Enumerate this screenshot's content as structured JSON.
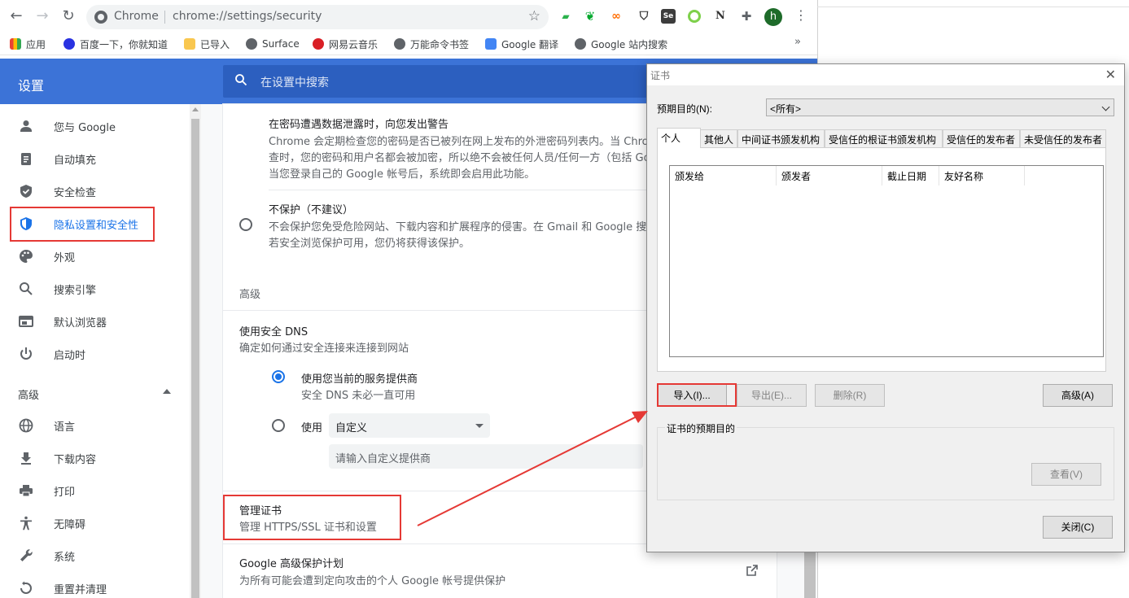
{
  "browser": {
    "omnibox_site": "Chrome",
    "url": "chrome://settings/security",
    "bookmarks": [
      "应用",
      "百度一下，你就知道",
      "已导入",
      "Surface",
      "网易云音乐",
      "万能命令书签",
      "Google 翻译",
      "Google 站内搜索"
    ],
    "more": "»",
    "avatar_letter": "h",
    "extension_icons": [
      "feedly-icon",
      "evernote-icon",
      "infinity-icon",
      "shield-extension-icon",
      "selenium-icon",
      "circle-extension-icon",
      "notion-icon",
      "puzzle-icon"
    ]
  },
  "settings": {
    "title": "设置",
    "search_placeholder": "在设置中搜索",
    "sidebar": [
      {
        "label": "您与 Google",
        "icon": "person-icon"
      },
      {
        "label": "自动填充",
        "icon": "clipboard-icon"
      },
      {
        "label": "安全检查",
        "icon": "shield-check-icon"
      },
      {
        "label": "隐私设置和安全性",
        "icon": "shield-privacy-icon"
      },
      {
        "label": "外观",
        "icon": "palette-icon"
      },
      {
        "label": "搜索引擎",
        "icon": "search-icon"
      },
      {
        "label": "默认浏览器",
        "icon": "browser-icon"
      },
      {
        "label": "启动时",
        "icon": "power-icon"
      }
    ],
    "sidebar_advanced": "高级",
    "sidebar_advanced_items": [
      {
        "label": "语言",
        "icon": "globe-icon"
      },
      {
        "label": "下载内容",
        "icon": "download-icon"
      },
      {
        "label": "打印",
        "icon": "printer-icon"
      },
      {
        "label": "无障碍",
        "icon": "accessibility-icon"
      },
      {
        "label": "系统",
        "icon": "wrench-icon"
      },
      {
        "label": "重置并清理",
        "icon": "reset-icon"
      }
    ],
    "content": {
      "breach_title": "在密码遭遇数据泄露时，向您发出警告",
      "breach_desc": [
        "Chrome 会定期检查您的密码是否已被列在网上发布的外泄密码列表内。当 Chrom",
        "查时，您的密码和用户名都会被加密，所以绝不会被任何人员/任何一方（包括 Go",
        "当您登录自己的 Google 帐号后，系统即会启用此功能。"
      ],
      "no_protect_title": "不保护（不建议）",
      "no_protect_desc": [
        "不会保护您免受危险网站、下载内容和扩展程序的侵害。在 Gmail 和 Google 搜索",
        "若安全浏览保护可用，您仍将获得该保护。"
      ],
      "advanced": "高级",
      "dns_title": "使用安全 DNS",
      "dns_desc": "确定如何通过安全连接来连接到网站",
      "dns_current": "使用您当前的服务提供商",
      "dns_current_desc": "安全 DNS 未必一直可用",
      "dns_use": "使用",
      "dns_custom": "自定义",
      "dns_custom_placeholder": "请输入自定义提供商",
      "cert_title": "管理证书",
      "cert_desc": "管理 HTTPS/SSL 证书和设置",
      "gapp_title": "Google 高级保护计划",
      "gapp_desc": "为所有可能会遭到定向攻击的个人 Google 帐号提供保护"
    }
  },
  "dialog": {
    "title": "证书",
    "purpose_label": "预期目的(N):",
    "purpose_value": "<所有>",
    "tabs": [
      "个人",
      "其他人",
      "中间证书颁发机构",
      "受信任的根证书颁发机构",
      "受信任的发布者",
      "未受信任的发布者"
    ],
    "columns": [
      "颁发给",
      "颁发者",
      "截止日期",
      "友好名称"
    ],
    "import": "导入(I)...",
    "export": "导出(E)...",
    "remove": "删除(R)",
    "advanced": "高级(A)",
    "purposes_group": "证书的预期目的",
    "view": "查看(V)",
    "close": "关闭(C)"
  }
}
